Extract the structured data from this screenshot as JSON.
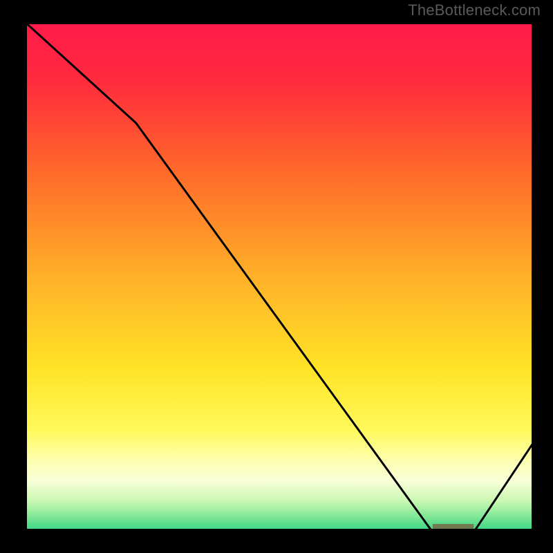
{
  "watermark": "TheBottleneck.com",
  "chart_data": {
    "type": "line",
    "title": "",
    "xlabel": "",
    "ylabel": "",
    "ylim": [
      0,
      100
    ],
    "xlim": [
      0,
      100
    ],
    "x": [
      0,
      22,
      80,
      88,
      100
    ],
    "values": [
      100,
      80,
      0,
      0,
      18
    ],
    "shaded_region": {
      "x_start": 80,
      "x_end": 88,
      "label_text": ""
    },
    "background_gradient": {
      "stops": [
        {
          "pos": 0.0,
          "color": "#ff1a4b"
        },
        {
          "pos": 0.12,
          "color": "#ff2b3d"
        },
        {
          "pos": 0.3,
          "color": "#ff6b2a"
        },
        {
          "pos": 0.5,
          "color": "#ffb028"
        },
        {
          "pos": 0.68,
          "color": "#ffe326"
        },
        {
          "pos": 0.8,
          "color": "#fff95a"
        },
        {
          "pos": 0.86,
          "color": "#fdffb0"
        },
        {
          "pos": 0.9,
          "color": "#f8ffd8"
        },
        {
          "pos": 0.94,
          "color": "#c8f7b0"
        },
        {
          "pos": 0.97,
          "color": "#7ee796"
        },
        {
          "pos": 1.0,
          "color": "#2fd082"
        }
      ]
    }
  }
}
